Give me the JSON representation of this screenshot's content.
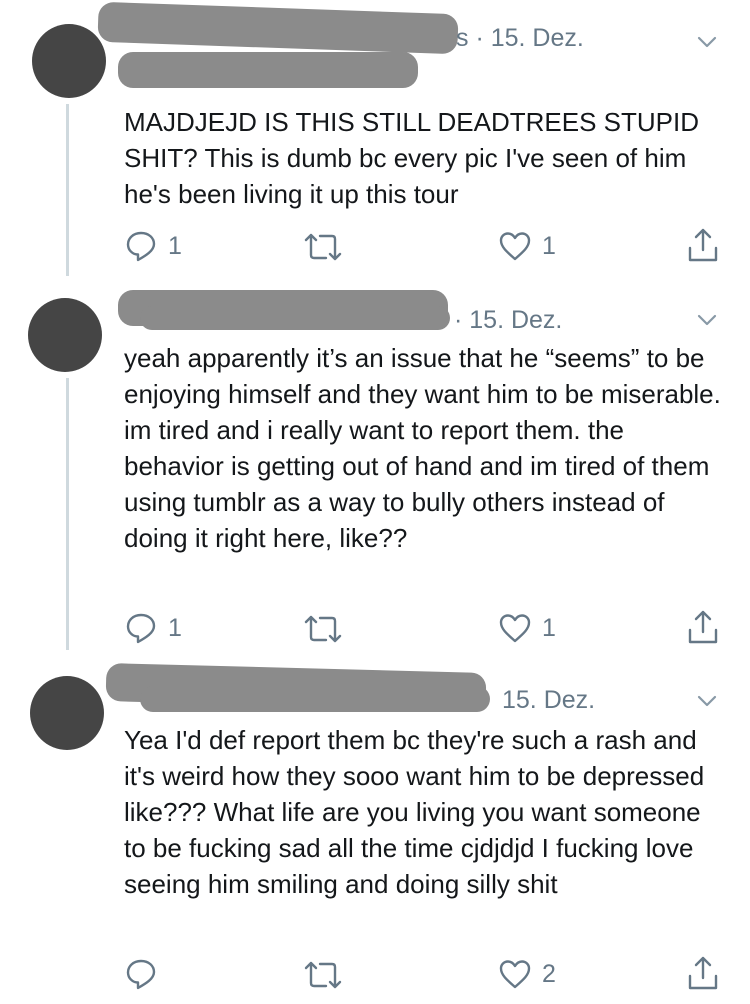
{
  "tweets": [
    {
      "date": "s · 15. Dez.",
      "text": "MAJDJEJD IS THIS STILL DEADTREES STUPID SHIT? This is dumb bc every pic I've seen of him he's been living it up this tour",
      "replies": "1",
      "retweets": "",
      "likes": "1"
    },
    {
      "date": "· 15. Dez.",
      "text": "yeah apparently it’s an issue that he “seems” to be enjoying himself and they want him to be miserable. im tired and i really want to report them. the behavior is getting out of hand and im tired of them using tumblr as a way to bully others instead of doing it right here, like??",
      "replies": "1",
      "retweets": "",
      "likes": "1"
    },
    {
      "date": "15. Dez.",
      "text": "Yea I'd def report them bc they're such a rash and it's weird how they sooo want him to be depressed like??? What life are you living you want someone to be fucking sad all the time cjdjdjd I fucking love seeing him smiling and doing silly shit",
      "replies": "",
      "retweets": "",
      "likes": "2"
    }
  ],
  "icons": [
    "reply-icon",
    "retweet-icon",
    "like-icon",
    "share-icon",
    "chevron-down-icon"
  ],
  "colors": {
    "text": "#14171a",
    "secondary": "#657786",
    "redaction": "#8b8b8b",
    "thread_line": "#cfd9de"
  }
}
